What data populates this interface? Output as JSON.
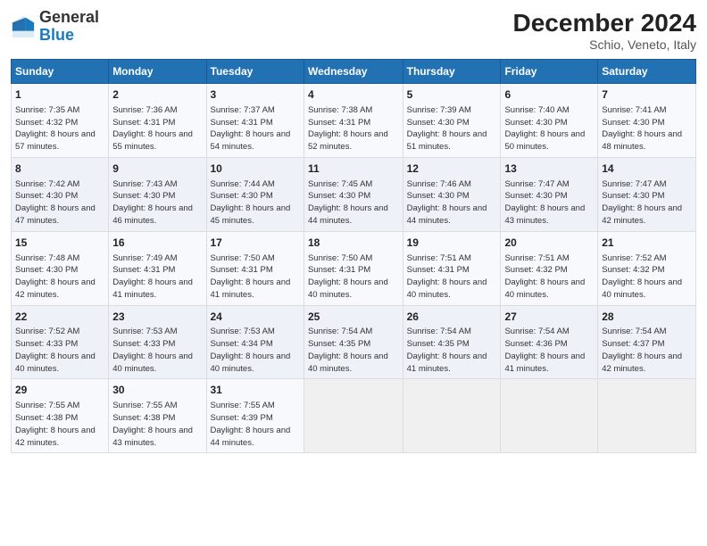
{
  "logo": {
    "general": "General",
    "blue": "Blue"
  },
  "header": {
    "month": "December 2024",
    "location": "Schio, Veneto, Italy"
  },
  "weekdays": [
    "Sunday",
    "Monday",
    "Tuesday",
    "Wednesday",
    "Thursday",
    "Friday",
    "Saturday"
  ],
  "weeks": [
    [
      {
        "day": "1",
        "sunrise": "Sunrise: 7:35 AM",
        "sunset": "Sunset: 4:32 PM",
        "daylight": "Daylight: 8 hours and 57 minutes."
      },
      {
        "day": "2",
        "sunrise": "Sunrise: 7:36 AM",
        "sunset": "Sunset: 4:31 PM",
        "daylight": "Daylight: 8 hours and 55 minutes."
      },
      {
        "day": "3",
        "sunrise": "Sunrise: 7:37 AM",
        "sunset": "Sunset: 4:31 PM",
        "daylight": "Daylight: 8 hours and 54 minutes."
      },
      {
        "day": "4",
        "sunrise": "Sunrise: 7:38 AM",
        "sunset": "Sunset: 4:31 PM",
        "daylight": "Daylight: 8 hours and 52 minutes."
      },
      {
        "day": "5",
        "sunrise": "Sunrise: 7:39 AM",
        "sunset": "Sunset: 4:30 PM",
        "daylight": "Daylight: 8 hours and 51 minutes."
      },
      {
        "day": "6",
        "sunrise": "Sunrise: 7:40 AM",
        "sunset": "Sunset: 4:30 PM",
        "daylight": "Daylight: 8 hours and 50 minutes."
      },
      {
        "day": "7",
        "sunrise": "Sunrise: 7:41 AM",
        "sunset": "Sunset: 4:30 PM",
        "daylight": "Daylight: 8 hours and 48 minutes."
      }
    ],
    [
      {
        "day": "8",
        "sunrise": "Sunrise: 7:42 AM",
        "sunset": "Sunset: 4:30 PM",
        "daylight": "Daylight: 8 hours and 47 minutes."
      },
      {
        "day": "9",
        "sunrise": "Sunrise: 7:43 AM",
        "sunset": "Sunset: 4:30 PM",
        "daylight": "Daylight: 8 hours and 46 minutes."
      },
      {
        "day": "10",
        "sunrise": "Sunrise: 7:44 AM",
        "sunset": "Sunset: 4:30 PM",
        "daylight": "Daylight: 8 hours and 45 minutes."
      },
      {
        "day": "11",
        "sunrise": "Sunrise: 7:45 AM",
        "sunset": "Sunset: 4:30 PM",
        "daylight": "Daylight: 8 hours and 44 minutes."
      },
      {
        "day": "12",
        "sunrise": "Sunrise: 7:46 AM",
        "sunset": "Sunset: 4:30 PM",
        "daylight": "Daylight: 8 hours and 44 minutes."
      },
      {
        "day": "13",
        "sunrise": "Sunrise: 7:47 AM",
        "sunset": "Sunset: 4:30 PM",
        "daylight": "Daylight: 8 hours and 43 minutes."
      },
      {
        "day": "14",
        "sunrise": "Sunrise: 7:47 AM",
        "sunset": "Sunset: 4:30 PM",
        "daylight": "Daylight: 8 hours and 42 minutes."
      }
    ],
    [
      {
        "day": "15",
        "sunrise": "Sunrise: 7:48 AM",
        "sunset": "Sunset: 4:30 PM",
        "daylight": "Daylight: 8 hours and 42 minutes."
      },
      {
        "day": "16",
        "sunrise": "Sunrise: 7:49 AM",
        "sunset": "Sunset: 4:31 PM",
        "daylight": "Daylight: 8 hours and 41 minutes."
      },
      {
        "day": "17",
        "sunrise": "Sunrise: 7:50 AM",
        "sunset": "Sunset: 4:31 PM",
        "daylight": "Daylight: 8 hours and 41 minutes."
      },
      {
        "day": "18",
        "sunrise": "Sunrise: 7:50 AM",
        "sunset": "Sunset: 4:31 PM",
        "daylight": "Daylight: 8 hours and 40 minutes."
      },
      {
        "day": "19",
        "sunrise": "Sunrise: 7:51 AM",
        "sunset": "Sunset: 4:31 PM",
        "daylight": "Daylight: 8 hours and 40 minutes."
      },
      {
        "day": "20",
        "sunrise": "Sunrise: 7:51 AM",
        "sunset": "Sunset: 4:32 PM",
        "daylight": "Daylight: 8 hours and 40 minutes."
      },
      {
        "day": "21",
        "sunrise": "Sunrise: 7:52 AM",
        "sunset": "Sunset: 4:32 PM",
        "daylight": "Daylight: 8 hours and 40 minutes."
      }
    ],
    [
      {
        "day": "22",
        "sunrise": "Sunrise: 7:52 AM",
        "sunset": "Sunset: 4:33 PM",
        "daylight": "Daylight: 8 hours and 40 minutes."
      },
      {
        "day": "23",
        "sunrise": "Sunrise: 7:53 AM",
        "sunset": "Sunset: 4:33 PM",
        "daylight": "Daylight: 8 hours and 40 minutes."
      },
      {
        "day": "24",
        "sunrise": "Sunrise: 7:53 AM",
        "sunset": "Sunset: 4:34 PM",
        "daylight": "Daylight: 8 hours and 40 minutes."
      },
      {
        "day": "25",
        "sunrise": "Sunrise: 7:54 AM",
        "sunset": "Sunset: 4:35 PM",
        "daylight": "Daylight: 8 hours and 40 minutes."
      },
      {
        "day": "26",
        "sunrise": "Sunrise: 7:54 AM",
        "sunset": "Sunset: 4:35 PM",
        "daylight": "Daylight: 8 hours and 41 minutes."
      },
      {
        "day": "27",
        "sunrise": "Sunrise: 7:54 AM",
        "sunset": "Sunset: 4:36 PM",
        "daylight": "Daylight: 8 hours and 41 minutes."
      },
      {
        "day": "28",
        "sunrise": "Sunrise: 7:54 AM",
        "sunset": "Sunset: 4:37 PM",
        "daylight": "Daylight: 8 hours and 42 minutes."
      }
    ],
    [
      {
        "day": "29",
        "sunrise": "Sunrise: 7:55 AM",
        "sunset": "Sunset: 4:38 PM",
        "daylight": "Daylight: 8 hours and 42 minutes."
      },
      {
        "day": "30",
        "sunrise": "Sunrise: 7:55 AM",
        "sunset": "Sunset: 4:38 PM",
        "daylight": "Daylight: 8 hours and 43 minutes."
      },
      {
        "day": "31",
        "sunrise": "Sunrise: 7:55 AM",
        "sunset": "Sunset: 4:39 PM",
        "daylight": "Daylight: 8 hours and 44 minutes."
      },
      null,
      null,
      null,
      null
    ]
  ]
}
